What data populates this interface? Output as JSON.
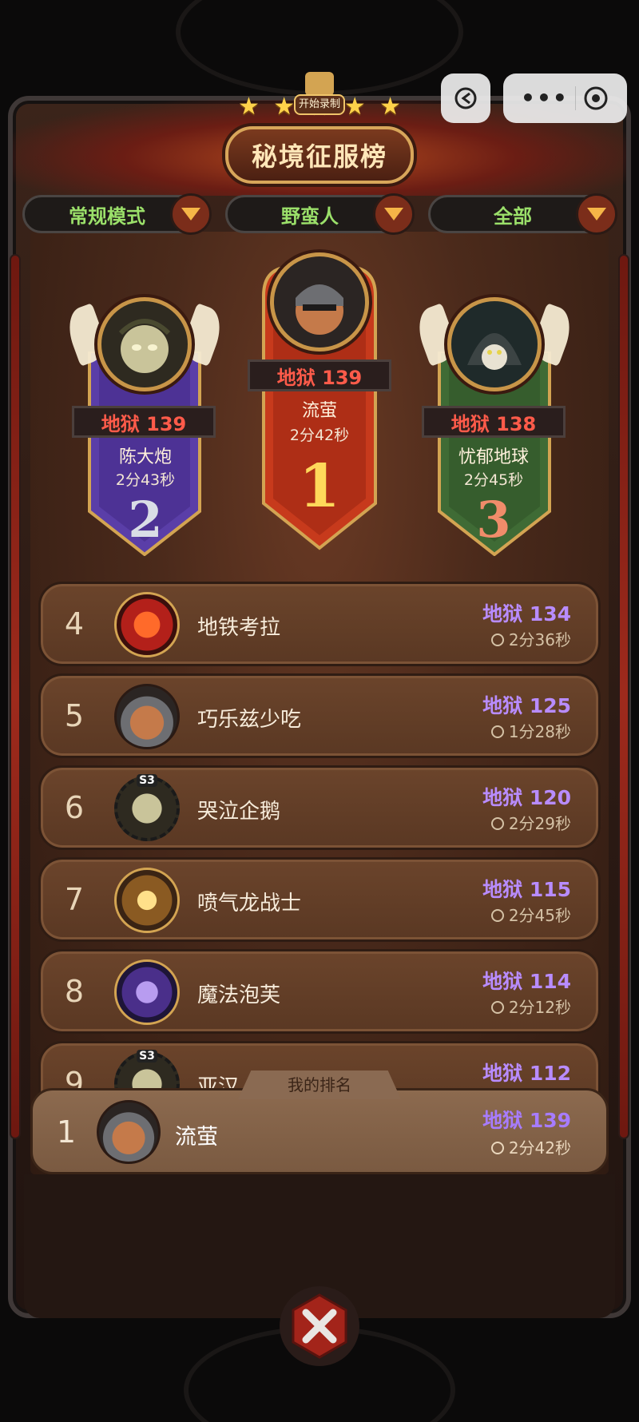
{
  "title": "秘境征服榜",
  "record_label": "开始录制",
  "filters": [
    {
      "label": "常规模式"
    },
    {
      "label": "野蛮人"
    },
    {
      "label": "全部"
    }
  ],
  "podium": {
    "first": {
      "rank": "1",
      "level": "地狱 139",
      "name": "流萤",
      "time": "2分42秒"
    },
    "second": {
      "rank": "2",
      "level": "地狱 139",
      "name": "陈大炮",
      "time": "2分43秒"
    },
    "third": {
      "rank": "3",
      "level": "地狱 138",
      "name": "忧郁地球",
      "time": "2分45秒"
    }
  },
  "rows": [
    {
      "rank": "4",
      "name": "地铁考拉",
      "level": "地狱 134",
      "time": "2分36秒"
    },
    {
      "rank": "5",
      "name": "巧乐兹少吃",
      "level": "地狱 125",
      "time": "1分28秒"
    },
    {
      "rank": "6",
      "name": "哭泣企鹅",
      "level": "地狱 120",
      "time": "2分29秒",
      "badge": "S3"
    },
    {
      "rank": "7",
      "name": "喷气龙战士",
      "level": "地狱 115",
      "time": "2分45秒"
    },
    {
      "rank": "8",
      "name": "魔法泡芙",
      "level": "地狱 114",
      "time": "2分12秒"
    },
    {
      "rank": "9",
      "name": "亚汉",
      "level": "地狱 112",
      "badge": "S3"
    }
  ],
  "my_rank": {
    "tab_label": "我的排名",
    "rank": "1",
    "name": "流萤",
    "level": "地狱 139",
    "time": "2分42秒"
  },
  "colors": {
    "level_purple": "#b88cff",
    "filter_green": "#9be06a",
    "podium_red": "#ff5b4a"
  },
  "icons": [
    "back-icon",
    "more-icon",
    "target-icon",
    "clock-icon",
    "close-icon",
    "star-icon",
    "dropdown-icon"
  ]
}
